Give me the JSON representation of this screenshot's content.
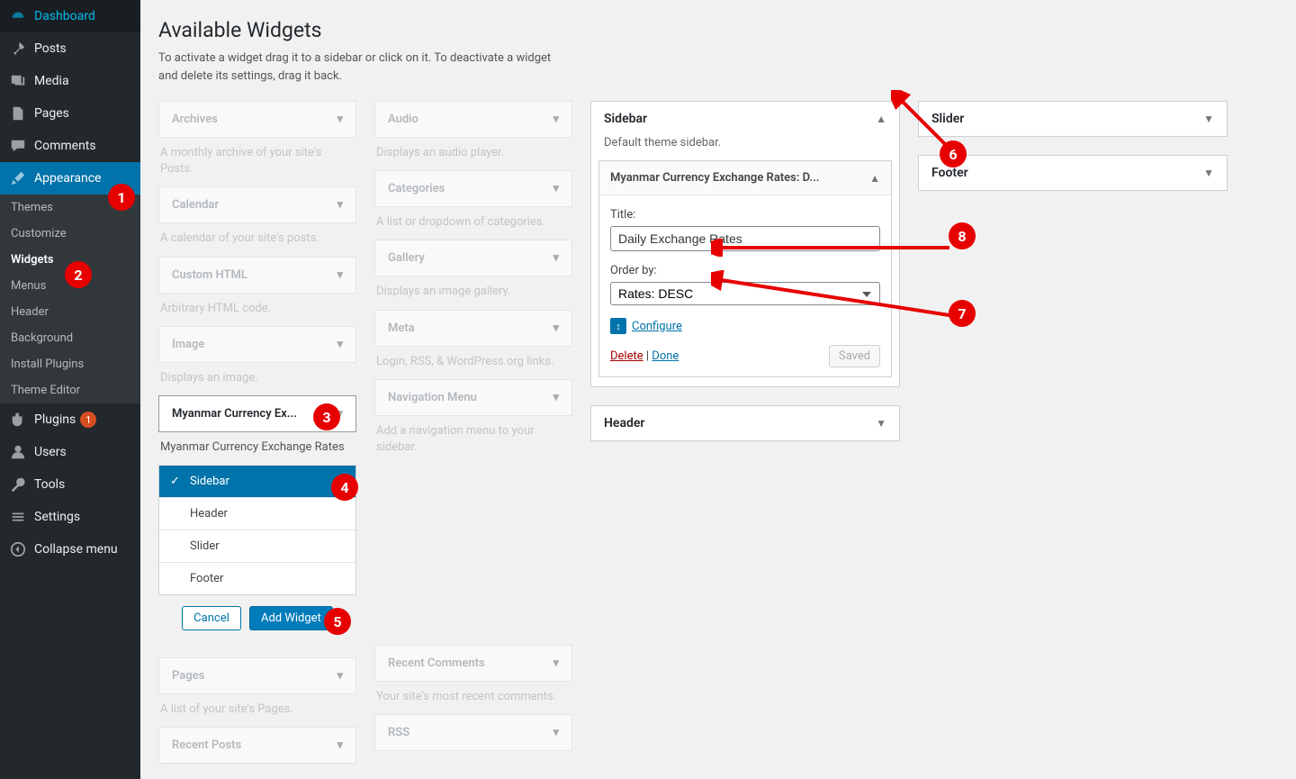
{
  "sidebar": {
    "items": [
      {
        "icon": "dashboard",
        "label": "Dashboard"
      },
      {
        "icon": "pin",
        "label": "Posts"
      },
      {
        "icon": "media",
        "label": "Media"
      },
      {
        "icon": "page",
        "label": "Pages"
      },
      {
        "icon": "comment",
        "label": "Comments"
      },
      {
        "icon": "brush",
        "label": "Appearance",
        "active": true
      },
      {
        "icon": "plugin",
        "label": "Plugins",
        "badge": "1"
      },
      {
        "icon": "user",
        "label": "Users"
      },
      {
        "icon": "tool",
        "label": "Tools"
      },
      {
        "icon": "settings",
        "label": "Settings"
      },
      {
        "icon": "collapse",
        "label": "Collapse menu"
      }
    ],
    "submenu": [
      "Themes",
      "Customize",
      "Widgets",
      "Menus",
      "Header",
      "Background",
      "Install Plugins",
      "Theme Editor"
    ],
    "submenu_current": "Widgets"
  },
  "page": {
    "title": "Available Widgets",
    "desc": "To activate a widget drag it to a sidebar or click on it. To deactivate a widget and delete its settings, drag it back."
  },
  "available_widgets_left": [
    {
      "title": "Archives",
      "desc": "A monthly archive of your site's Posts."
    },
    {
      "title": "Calendar",
      "desc": "A calendar of your site's posts."
    },
    {
      "title": "Custom HTML",
      "desc": "Arbitrary HTML code."
    },
    {
      "title": "Image",
      "desc": "Displays an image."
    },
    {
      "title": "Myanmar Currency Ex...",
      "desc": "Myanmar Currency Exchange Rates",
      "highlight": true,
      "chooser": true
    },
    {
      "title": "Pages",
      "desc": "A list of your site's Pages."
    },
    {
      "title": "Recent Posts",
      "desc": ""
    }
  ],
  "available_widgets_right": [
    {
      "title": "Audio",
      "desc": "Displays an audio player."
    },
    {
      "title": "Categories",
      "desc": "A list or dropdown of categories."
    },
    {
      "title": "Gallery",
      "desc": "Displays an image gallery."
    },
    {
      "title": "Meta",
      "desc": "Login, RSS, & WordPress.org links."
    },
    {
      "title": "Navigation Menu",
      "desc": "Add a navigation menu to your sidebar."
    },
    {
      "title": "Recent Comments",
      "desc": "Your site's most recent comments."
    },
    {
      "title": "RSS",
      "desc": ""
    }
  ],
  "chooser": {
    "options": [
      "Sidebar",
      "Header",
      "Slider",
      "Footer"
    ],
    "selected": "Sidebar",
    "cancel": "Cancel",
    "add": "Add Widget"
  },
  "areas_col1": [
    {
      "name": "Sidebar",
      "desc": "Default theme sidebar.",
      "expanded": true,
      "widgets": [
        {
          "title": "Myanmar Currency Exchange Rates: D...",
          "expanded": true,
          "form": {
            "title_label": "Title:",
            "title_value": "Daily Exchange Rates",
            "order_label": "Order by:",
            "order_value": "Rates: DESC",
            "configure": "Configure",
            "delete": "Delete",
            "done": "Done",
            "saved": "Saved"
          }
        }
      ]
    },
    {
      "name": "Header",
      "expanded": false
    }
  ],
  "areas_col2": [
    {
      "name": "Slider",
      "expanded": false
    },
    {
      "name": "Footer",
      "expanded": false
    }
  ],
  "callouts": {
    "1": "1",
    "2": "2",
    "3": "3",
    "4": "4",
    "5": "5",
    "6": "6",
    "7": "7",
    "8": "8"
  }
}
